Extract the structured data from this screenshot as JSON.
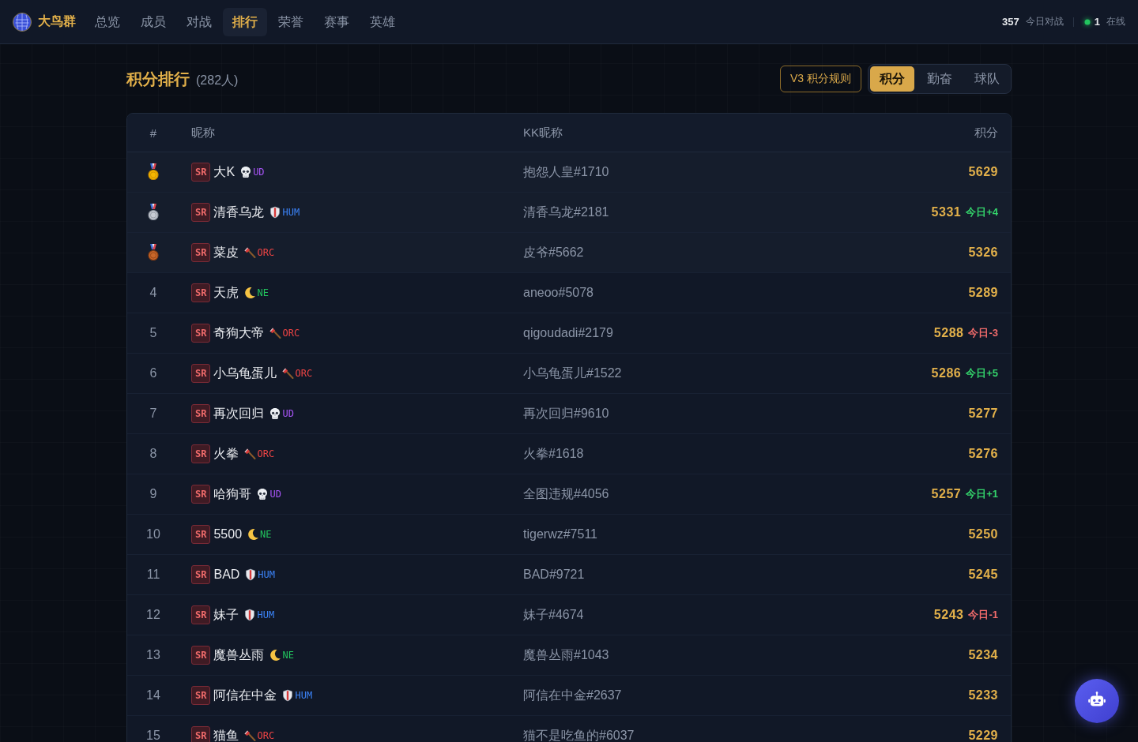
{
  "nav": {
    "brand": "大鸟群",
    "items": [
      {
        "label": "总览",
        "selected": false
      },
      {
        "label": "成员",
        "selected": false
      },
      {
        "label": "对战",
        "selected": false
      },
      {
        "label": "排行",
        "selected": true
      },
      {
        "label": "荣誉",
        "selected": false
      },
      {
        "label": "赛事",
        "selected": false
      },
      {
        "label": "英雄",
        "selected": false
      }
    ]
  },
  "stats": [
    {
      "kind": "plain",
      "value": "357",
      "label": "今日对战"
    },
    {
      "kind": "online",
      "value": "1",
      "label": "在线"
    }
  ],
  "page": {
    "title": "积分排行",
    "count": "(282人)"
  },
  "rules_button": "V3 积分规则",
  "view_tabs": [
    {
      "label": "积分",
      "selected": true
    },
    {
      "label": "勤奋",
      "selected": false
    },
    {
      "label": "球队",
      "selected": false
    }
  ],
  "table": {
    "columns": [
      "#",
      "昵称",
      "KK昵称",
      "积分"
    ],
    "rows": [
      {
        "kind": "gold",
        "tier": "SR",
        "name": "大K",
        "race": {
          "kind": "undead",
          "label": "UD",
          "color": "#a855f7"
        },
        "kk": "抱怨人皇#1710",
        "score": "5629"
      },
      {
        "kind": "silver",
        "tier": "SR",
        "name": "清香乌龙",
        "race": {
          "kind": "human",
          "label": "HUM",
          "color": "#3b82f6"
        },
        "kk": "清香乌龙#2181",
        "score": "5331",
        "today": {
          "kind": "up",
          "text": "今日+4"
        }
      },
      {
        "kind": "bronze",
        "tier": "SR",
        "name": "菜皮",
        "race": {
          "kind": "orc",
          "label": "ORC",
          "color": "#ef4444"
        },
        "kk": "皮爷#5662",
        "score": "5326"
      },
      {
        "kind": "plain",
        "rank": "4",
        "tier": "SR",
        "name": "天虎",
        "race": {
          "kind": "nightelf",
          "label": "NE",
          "color": "#22c55e"
        },
        "kk": "aneoo#5078",
        "score": "5289"
      },
      {
        "kind": "plain",
        "rank": "5",
        "tier": "SR",
        "name": "奇狗大帝",
        "race": {
          "kind": "orc",
          "label": "ORC",
          "color": "#ef4444"
        },
        "kk": "qigoudadi#2179",
        "score": "5288",
        "today": {
          "kind": "down",
          "text": "今日-3"
        }
      },
      {
        "kind": "plain",
        "rank": "6",
        "tier": "SR",
        "name": "小乌龟蛋儿",
        "race": {
          "kind": "orc",
          "label": "ORC",
          "color": "#ef4444"
        },
        "kk": "小乌龟蛋儿#1522",
        "score": "5286",
        "today": {
          "kind": "up",
          "text": "今日+5"
        }
      },
      {
        "kind": "plain",
        "rank": "7",
        "tier": "SR",
        "name": "再次回归",
        "race": {
          "kind": "undead",
          "label": "UD",
          "color": "#a855f7"
        },
        "kk": "再次回归#9610",
        "score": "5277"
      },
      {
        "kind": "plain",
        "rank": "8",
        "tier": "SR",
        "name": "火拳",
        "race": {
          "kind": "orc",
          "label": "ORC",
          "color": "#ef4444"
        },
        "kk": "火拳#1618",
        "score": "5276"
      },
      {
        "kind": "plain",
        "rank": "9",
        "tier": "SR",
        "name": "哈狗哥",
        "race": {
          "kind": "undead",
          "label": "UD",
          "color": "#a855f7"
        },
        "kk": "全图违规#4056",
        "score": "5257",
        "today": {
          "kind": "up",
          "text": "今日+1"
        }
      },
      {
        "kind": "plain",
        "rank": "10",
        "tier": "SR",
        "name": "5500",
        "race": {
          "kind": "nightelf",
          "label": "NE",
          "color": "#22c55e"
        },
        "kk": "tigerwz#7511",
        "score": "5250"
      },
      {
        "kind": "plain",
        "rank": "11",
        "tier": "SR",
        "name": "BAD",
        "race": {
          "kind": "human",
          "label": "HUM",
          "color": "#3b82f6"
        },
        "kk": "BAD#9721",
        "score": "5245"
      },
      {
        "kind": "plain",
        "rank": "12",
        "tier": "SR",
        "name": "妹子",
        "race": {
          "kind": "human",
          "label": "HUM",
          "color": "#3b82f6"
        },
        "kk": "妹子#4674",
        "score": "5243",
        "today": {
          "kind": "down",
          "text": "今日-1"
        }
      },
      {
        "kind": "plain",
        "rank": "13",
        "tier": "SR",
        "name": "魔兽丛雨",
        "race": {
          "kind": "nightelf",
          "label": "NE",
          "color": "#22c55e"
        },
        "kk": "魔兽丛雨#1043",
        "score": "5234"
      },
      {
        "kind": "plain",
        "rank": "14",
        "tier": "SR",
        "name": "阿信在中金",
        "race": {
          "kind": "human",
          "label": "HUM",
          "color": "#3b82f6"
        },
        "kk": "阿信在中金#2637",
        "score": "5233"
      },
      {
        "kind": "plain",
        "rank": "15",
        "tier": "SR",
        "name": "猫鱼",
        "race": {
          "kind": "orc",
          "label": "ORC",
          "color": "#ef4444"
        },
        "kk": "猫不是吃鱼的#6037",
        "score": "5229"
      }
    ]
  }
}
